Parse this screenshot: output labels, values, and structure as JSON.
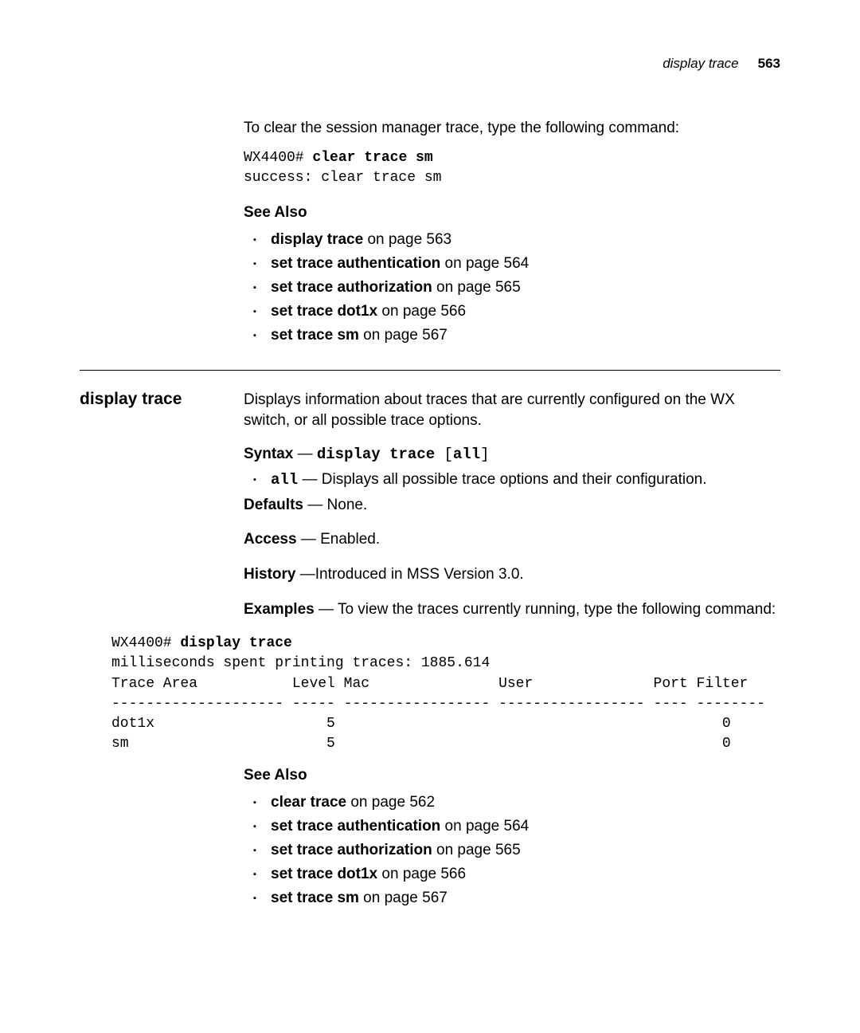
{
  "header": {
    "title": "display trace",
    "page": "563"
  },
  "intro": "To clear the session manager trace, type the following command:",
  "cmd1": {
    "prompt": "WX4400# ",
    "command": "clear trace sm",
    "output": "success: clear trace sm"
  },
  "see_also_1": {
    "heading": "See Also",
    "items": [
      {
        "bold": "display trace",
        "rest": " on page 563"
      },
      {
        "bold": "set trace authentication",
        "rest": " on page 564"
      },
      {
        "bold": "set trace authorization",
        "rest": " on page 565"
      },
      {
        "bold": "set trace dot1x",
        "rest": " on page 566"
      },
      {
        "bold": "set trace sm",
        "rest": " on page 567"
      }
    ]
  },
  "section": {
    "title": "display trace",
    "description": "Displays information about traces that are currently configured on the WX switch, or all possible trace options.",
    "syntax": {
      "label": "Syntax",
      "dash": " — ",
      "command": "display trace ",
      "bracket_open": "[",
      "all": "all",
      "bracket_close": "]"
    },
    "all_desc": {
      "code": "all",
      "dash": " — ",
      "text": "Displays all possible trace options and their configuration."
    },
    "defaults": {
      "label": "Defaults",
      "dash": " — ",
      "text": "None."
    },
    "access": {
      "label": "Access",
      "dash": " — ",
      "text": "Enabled."
    },
    "history": {
      "label": "History",
      "dash": " —",
      "text": "Introduced in MSS Version 3.0."
    },
    "examples": {
      "label": "Examples",
      "dash": " — ",
      "text": "To view the traces currently running, type the following command:"
    }
  },
  "example_output": {
    "prompt": "WX4400# ",
    "command": "display trace",
    "line1": "milliseconds spent printing traces: 1885.614",
    "line2": "Trace Area           Level Mac               User              Port Filter",
    "line3": "-------------------- ----- ----------------- ----------------- ---- --------",
    "line4": "dot1x                    5                                             0",
    "line5": "sm                       5                                             0"
  },
  "see_also_2": {
    "heading": "See Also",
    "items": [
      {
        "bold": "clear trace",
        "rest": " on page 562"
      },
      {
        "bold": "set trace authentication",
        "rest": " on page 564"
      },
      {
        "bold": "set trace authorization",
        "rest": " on page 565"
      },
      {
        "bold": "set trace dot1x",
        "rest": " on page 566"
      },
      {
        "bold": "set trace sm",
        "rest": " on page 567"
      }
    ]
  }
}
